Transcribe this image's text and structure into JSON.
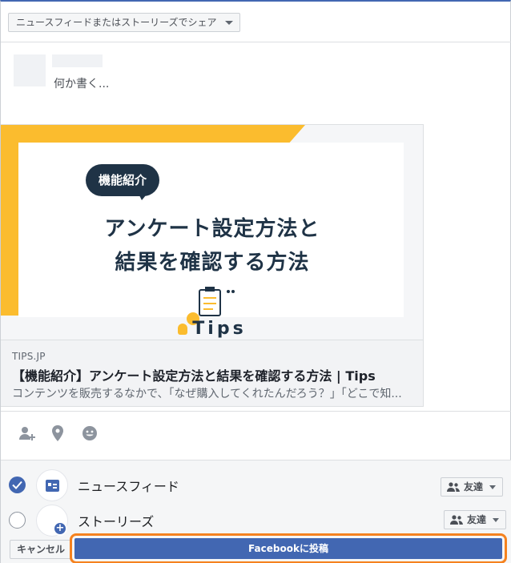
{
  "share_menu": {
    "label": "ニュースフィードまたはストーリーズでシェア"
  },
  "composer": {
    "placeholder": "何か書く..."
  },
  "link_card": {
    "image": {
      "badge": "機能紹介",
      "headline_line1": "アンケート設定方法と",
      "headline_line2": "結果を確認する方法",
      "logo": "Tips",
      "colors": {
        "accent": "#fbbc2e",
        "navy": "#1f3346"
      }
    },
    "domain": "TIPS.JP",
    "title": "【機能紹介】アンケート設定方法と結果を確認する方法 | Tips",
    "description": "コンテンツを販売するなかで、「なぜ購入してくれたんだろう？」「どこで知..."
  },
  "toolbar": {
    "icons": [
      "tag-friends-icon",
      "location-icon",
      "feeling-icon"
    ]
  },
  "destinations": [
    {
      "label": "ニュースフィード",
      "checked": true,
      "audience": "友達"
    },
    {
      "label": "ストーリーズ",
      "checked": false,
      "audience": "友達"
    }
  ],
  "actions": {
    "cancel_label": "キャンセル",
    "post_label": "Facebookに投稿"
  },
  "colors": {
    "brand": "#4267b2",
    "highlight": "#f5821f"
  }
}
